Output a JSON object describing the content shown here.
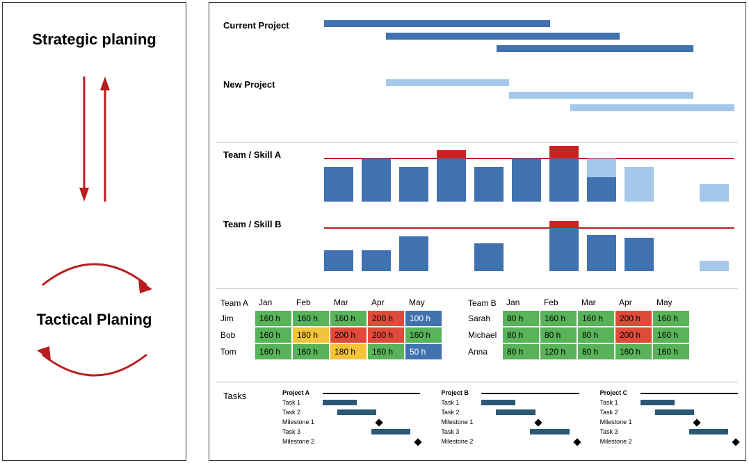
{
  "left": {
    "title1": "Strategic planing",
    "title2": "Tactical Planing"
  },
  "gantt": {
    "current_label": "Current Project",
    "new_label": "New Project"
  },
  "chart_data": {
    "type": "bar",
    "gantt_current": [
      {
        "start": 0,
        "end": 55
      },
      {
        "start": 15,
        "end": 72
      },
      {
        "start": 42,
        "end": 90
      }
    ],
    "gantt_new": [
      {
        "start": 15,
        "end": 45
      },
      {
        "start": 45,
        "end": 90
      },
      {
        "start": 60,
        "end": 100
      }
    ],
    "team_a_hist": [
      {
        "dark": 50,
        "light": 0,
        "red": 0
      },
      {
        "dark": 62,
        "light": 0,
        "red": 0
      },
      {
        "dark": 50,
        "light": 0,
        "red": 0
      },
      {
        "dark": 62,
        "light": 0,
        "red": 12
      },
      {
        "dark": 50,
        "light": 0,
        "red": 0
      },
      {
        "dark": 62,
        "light": 0,
        "red": 0
      },
      {
        "dark": 62,
        "light": 18,
        "red": 18
      },
      {
        "dark": 35,
        "light": 62,
        "red": 0
      },
      {
        "dark": 0,
        "light": 50,
        "red": 0
      },
      {
        "dark": 0,
        "light": 0,
        "red": 0
      },
      {
        "dark": 0,
        "light": 25,
        "red": 0
      }
    ],
    "team_b_hist": [
      {
        "dark": 30,
        "light": 0,
        "red": 0
      },
      {
        "dark": 30,
        "light": 0,
        "red": 0
      },
      {
        "dark": 50,
        "light": 0,
        "red": 0
      },
      {
        "dark": 0,
        "light": 0,
        "red": 0
      },
      {
        "dark": 40,
        "light": 0,
        "red": 0
      },
      {
        "dark": 0,
        "light": 0,
        "red": 0
      },
      {
        "dark": 62,
        "light": 10,
        "red": 10
      },
      {
        "dark": 52,
        "light": 0,
        "red": 0
      },
      {
        "dark": 48,
        "light": 0,
        "red": 0
      },
      {
        "dark": 0,
        "light": 0,
        "red": 0
      },
      {
        "dark": 0,
        "light": 15,
        "red": 0
      }
    ]
  },
  "hist": {
    "labelA": "Team / Skill A",
    "labelB": "Team / Skill B"
  },
  "tables": {
    "months": [
      "Jan",
      "Feb",
      "Mar",
      "Apr",
      "May"
    ],
    "teamA": {
      "name": "Team A",
      "rows": [
        {
          "name": "Jim",
          "cells": [
            {
              "v": "160 h",
              "c": "green"
            },
            {
              "v": "160 h",
              "c": "green"
            },
            {
              "v": "160 h",
              "c": "green"
            },
            {
              "v": "200 h",
              "c": "red"
            },
            {
              "v": "100 h",
              "c": "blue"
            }
          ]
        },
        {
          "name": "Bob",
          "cells": [
            {
              "v": "160 h",
              "c": "green"
            },
            {
              "v": "180 h",
              "c": "yellow"
            },
            {
              "v": "200 h",
              "c": "red"
            },
            {
              "v": "200 h",
              "c": "red"
            },
            {
              "v": "160 h",
              "c": "green"
            }
          ]
        },
        {
          "name": "Tom",
          "cells": [
            {
              "v": "160 h",
              "c": "green"
            },
            {
              "v": "160 h",
              "c": "green"
            },
            {
              "v": "180 h",
              "c": "yellow"
            },
            {
              "v": "160 h",
              "c": "green"
            },
            {
              "v": "50 h",
              "c": "blue"
            }
          ]
        }
      ]
    },
    "teamB": {
      "name": "Team B",
      "rows": [
        {
          "name": "Sarah",
          "cells": [
            {
              "v": "80 h",
              "c": "green"
            },
            {
              "v": "160 h",
              "c": "green"
            },
            {
              "v": "160 h",
              "c": "green"
            },
            {
              "v": "200 h",
              "c": "red"
            },
            {
              "v": "160 h",
              "c": "green"
            }
          ]
        },
        {
          "name": "Michael",
          "cells": [
            {
              "v": "80 h",
              "c": "green"
            },
            {
              "v": "80 h",
              "c": "green"
            },
            {
              "v": "80 h",
              "c": "green"
            },
            {
              "v": "200 h",
              "c": "red"
            },
            {
              "v": "160 h",
              "c": "green"
            }
          ]
        },
        {
          "name": "Anna",
          "cells": [
            {
              "v": "80 h",
              "c": "green"
            },
            {
              "v": "120 h",
              "c": "green"
            },
            {
              "v": "80 h",
              "c": "green"
            },
            {
              "v": "160 h",
              "c": "green"
            },
            {
              "v": "160 h",
              "c": "green"
            }
          ]
        }
      ]
    }
  },
  "tasks": {
    "label": "Tasks",
    "projects": [
      "Project A",
      "Project B",
      "Project C"
    ],
    "rows": [
      "Task 1",
      "Task 2",
      "Milestone 1",
      "Task 3",
      "Milestone 2"
    ],
    "bars": [
      {
        "type": "bar",
        "row": 1,
        "start": 0,
        "end": 35
      },
      {
        "type": "bar",
        "row": 2,
        "start": 15,
        "end": 55
      },
      {
        "type": "diamond",
        "row": 3,
        "pos": 55
      },
      {
        "type": "bar",
        "row": 4,
        "start": 50,
        "end": 90
      },
      {
        "type": "diamond",
        "row": 5,
        "pos": 95
      }
    ]
  }
}
